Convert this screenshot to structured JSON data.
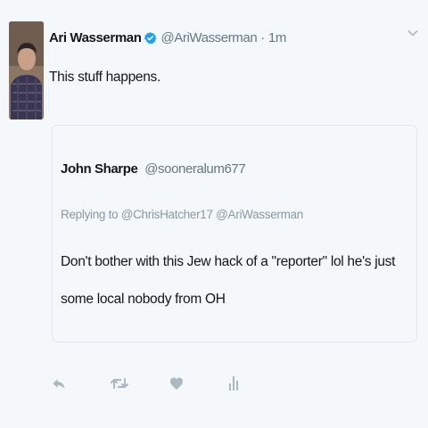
{
  "tweet": {
    "author_name": "Ari Wasserman",
    "author_handle": "@AriWasserman",
    "separator": "·",
    "timestamp": "1m",
    "text": "This stuff happens.",
    "verified": true
  },
  "quoted_tweet": {
    "author_name": "John Sharpe",
    "author_handle": "@sooneralum677",
    "replying_to_prefix": "Replying to",
    "replying_to": "@ChrisHatcher17 @AriWasserman",
    "text": "Don't bother with this Jew hack of a \"reporter\" lol he's just some local nobody from OH"
  },
  "actions": {
    "icons": [
      "reply-icon",
      "retweet-icon",
      "like-icon",
      "analytics-icon"
    ]
  },
  "colors": {
    "background": "#f5f8fa",
    "text": "#14171a",
    "secondary": "#657786",
    "verified": "#1da1f2",
    "icon": "#aab8c2",
    "border": "#e1e8ed"
  }
}
